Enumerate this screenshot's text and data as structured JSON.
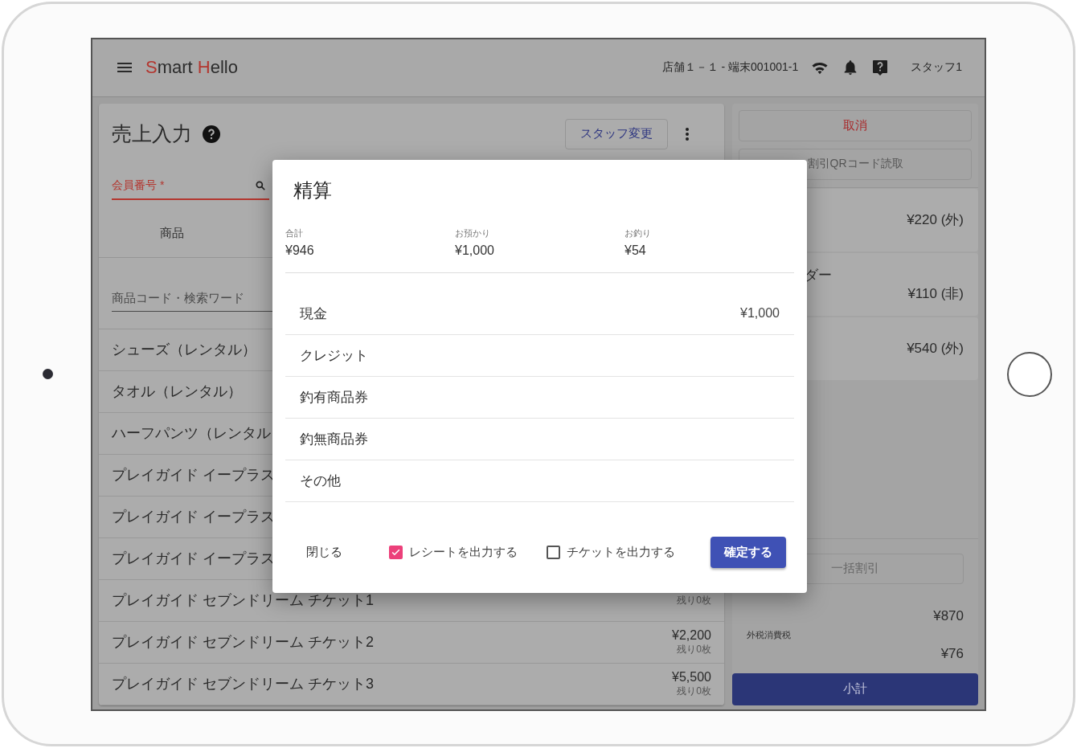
{
  "app_bar": {
    "logo": "Smart Hello",
    "terminal": "店舗１－１ - 端末001001-1",
    "user": "スタッフ1"
  },
  "sales": {
    "title": "売上入力",
    "staff_button": "スタッフ変更",
    "member_field": {
      "label": "会員番号 *"
    },
    "tabs": [
      {
        "label": "商品",
        "selected": true
      }
    ],
    "search": {
      "placeholder": "商品コード・検索ワード"
    },
    "products": [
      {
        "name": "シューズ（レンタル）"
      },
      {
        "name": "タオル（レンタル）"
      },
      {
        "name": "ハーフパンツ（レンタル"
      },
      {
        "name": "プレイガイド イープラス"
      },
      {
        "name": "プレイガイド イープラス"
      },
      {
        "name": "プレイガイド イープラス"
      },
      {
        "name": "プレイガイド セブンドリーム チケット1",
        "stock": "残り0枚"
      },
      {
        "name": "プレイガイド セブンドリーム チケット2",
        "price": "¥2,200",
        "stock": "残り0枚"
      },
      {
        "name": "プレイガイド セブンドリーム チケット3",
        "price": "¥5,500",
        "stock": "残り0枚"
      }
    ]
  },
  "cart": {
    "cancel_button": "取消",
    "qr_button": "割引QRコード読取",
    "items": [
      {
        "price": "¥220 (外)"
      },
      {
        "name": "ダー",
        "price": "¥110 (非)"
      },
      {
        "price": "¥540 (外)"
      }
    ],
    "discount_button": "一括割引",
    "total": "¥870",
    "tax_label": "外税消費税",
    "tax": "¥76",
    "subtotal_button": "小計"
  },
  "dialog": {
    "title": "精算",
    "summary": [
      {
        "label": "合計",
        "value": "¥946"
      },
      {
        "label": "お預かり",
        "value": "¥1,000"
      },
      {
        "label": "お釣り",
        "value": "¥54"
      }
    ],
    "payments": [
      {
        "label": "現金",
        "amount": "¥1,000"
      },
      {
        "label": "クレジット"
      },
      {
        "label": "釣有商品券"
      },
      {
        "label": "釣無商品券"
      },
      {
        "label": "その他"
      }
    ],
    "close_button": "閉じる",
    "options": [
      {
        "label": "レシートを出力する",
        "checked": true
      },
      {
        "label": "チケットを出力する",
        "checked": false
      }
    ],
    "confirm_button": "確定する"
  }
}
